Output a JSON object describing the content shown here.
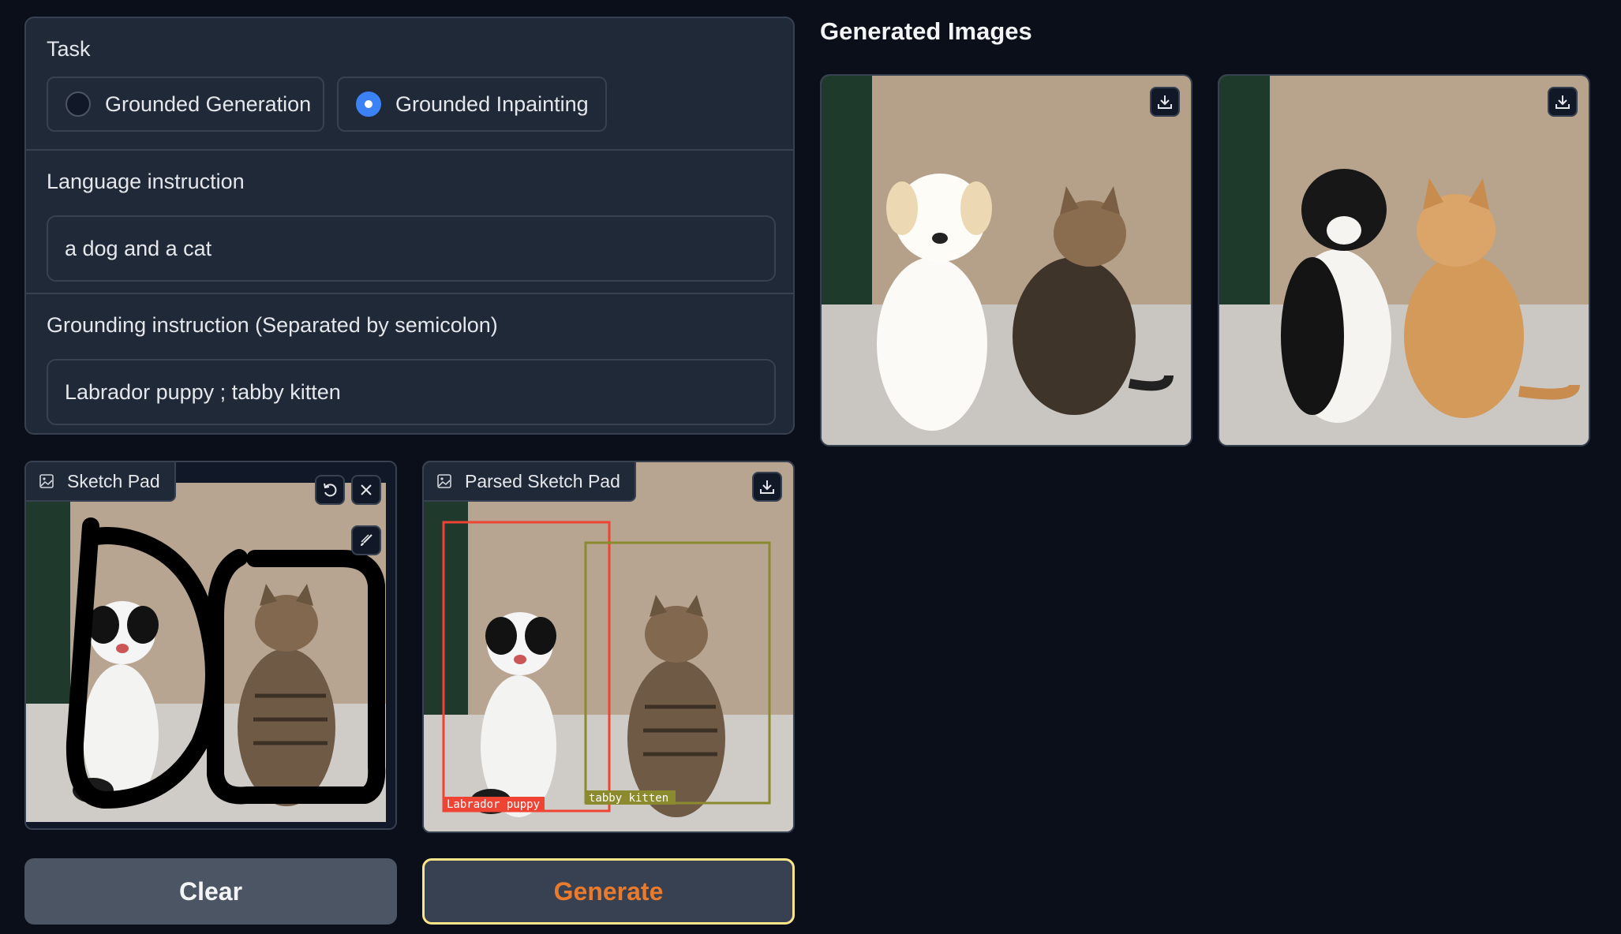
{
  "task": {
    "label": "Task",
    "options": [
      {
        "label": "Grounded Generation",
        "checked": false
      },
      {
        "label": "Grounded Inpainting",
        "checked": true
      }
    ]
  },
  "language_instruction": {
    "label": "Language instruction",
    "value": "a dog and a cat"
  },
  "grounding_instruction": {
    "label": "Grounding instruction (Separated by semicolon)",
    "value": "Labrador puppy ; tabby kitten"
  },
  "sketch_pad": {
    "label": "Sketch Pad",
    "icons": [
      "image-icon",
      "undo-icon",
      "close-icon",
      "brush-icon"
    ]
  },
  "parsed_sketch_pad": {
    "label": "Parsed Sketch Pad",
    "boxes": [
      {
        "label": "Labrador puppy",
        "color": "#ef4333"
      },
      {
        "label": "tabby kitten",
        "color": "#8b8a2e"
      }
    ],
    "icons": [
      "image-icon",
      "download-icon"
    ]
  },
  "buttons": {
    "clear": "Clear",
    "generate": "Generate"
  },
  "gallery": {
    "title": "Generated Images",
    "items": [
      {
        "description_icon": "download-icon"
      },
      {
        "description_icon": "download-icon"
      }
    ]
  },
  "colors": {
    "background": "#0b0f19",
    "panel": "#1f2937",
    "border": "#374151",
    "accent": "#3b82f6",
    "generate_text": "#ea7a2c"
  }
}
